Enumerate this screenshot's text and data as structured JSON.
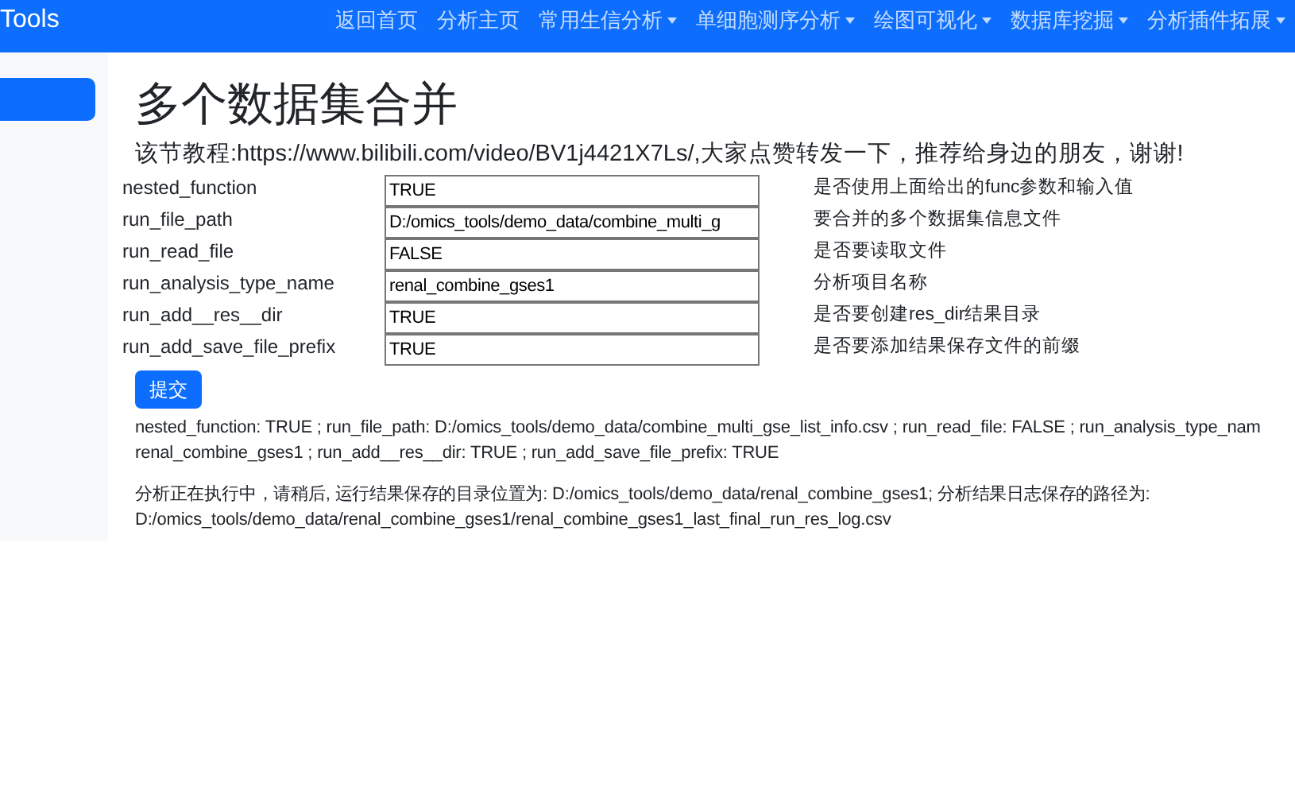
{
  "navbar": {
    "brand": "Tools",
    "items": [
      {
        "label": "返回首页",
        "kind": "link"
      },
      {
        "label": "分析主页",
        "kind": "link"
      },
      {
        "label": "常用生信分析",
        "kind": "dropdown"
      },
      {
        "label": "单细胞测序分析",
        "kind": "dropdown"
      },
      {
        "label": "绘图可视化",
        "kind": "dropdown"
      },
      {
        "label": "数据库挖掘",
        "kind": "dropdown"
      },
      {
        "label": "分析插件拓展",
        "kind": "dropdown"
      }
    ]
  },
  "sidebar": {
    "items": [
      {
        "selected": true
      }
    ]
  },
  "page": {
    "title": "多个数据集合并",
    "tutorial": "该节教程:https://www.bilibili.com/video/BV1j4421X7Ls/,大家点赞转发一下，推荐给身边的朋友，谢谢!",
    "params": [
      {
        "name": "nested_function",
        "value": "TRUE",
        "description": "是否使用上面给出的func参数和输入值"
      },
      {
        "name": "run_file_path",
        "value": "D:/omics_tools/demo_data/combine_multi_g",
        "description": "要合并的多个数据集信息文件"
      },
      {
        "name": "run_read_file",
        "value": "FALSE",
        "description": "是否要读取文件"
      },
      {
        "name": "run_analysis_type_name",
        "value": "renal_combine_gses1",
        "description": "分析项目名称"
      },
      {
        "name": "run_add__res__dir",
        "value": "TRUE",
        "description": "是否要创建res_dir结果目录"
      },
      {
        "name": "run_add_save_file_prefix",
        "value": "TRUE",
        "description": "是否要添加结果保存文件的前缀"
      }
    ],
    "submit": "提交",
    "summary": [
      "nested_function: TRUE ; run_file_path: D:/omics_tools/demo_data/combine_multi_gse_list_info.csv ; run_read_file: FALSE ; run_analysis_type_nam",
      "renal_combine_gses1 ; run_add__res__dir: TRUE ; run_add_save_file_prefix: TRUE"
    ],
    "status": [
      "分析正在执行中，请稍后, 运行结果保存的目录位置为: D:/omics_tools/demo_data/renal_combine_gses1; 分析结果日志保存的路径为:",
      "D:/omics_tools/demo_data/renal_combine_gses1/renal_combine_gses1_last_final_run_res_log.csv"
    ]
  }
}
